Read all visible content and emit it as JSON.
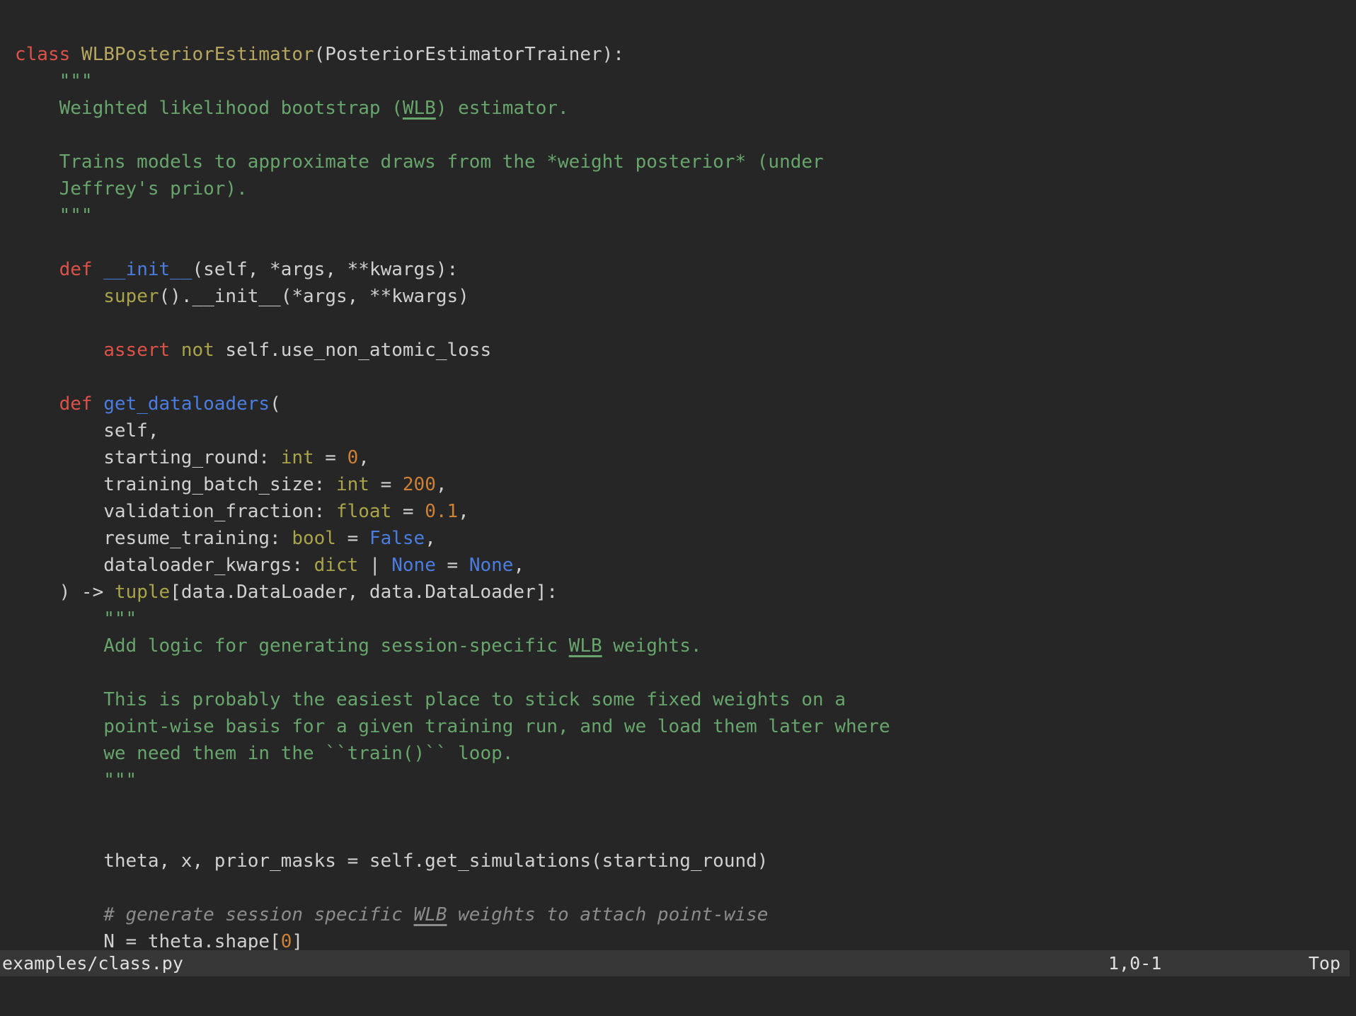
{
  "colors": {
    "background": "#262626",
    "text": "#d0d0d0",
    "keyword": "#dd5248",
    "class_name": "#b6a65f",
    "function": "#4b7de0",
    "constant": "#4b7de0",
    "type": "#a9a449",
    "string": "#67a56c",
    "number": "#cd8136",
    "comment": "#8c8c8c",
    "statusbar_bg": "#373737",
    "statusbar_text": "#e0e0e0"
  },
  "editor": {
    "code_lines": [
      [],
      [
        {
          "s": "kw",
          "t": "class "
        },
        {
          "s": "cls",
          "t": "WLBPosteriorEstimator"
        },
        {
          "s": "txt",
          "t": "(PosteriorEstimatorTrainer):"
        }
      ],
      [
        {
          "s": "str",
          "t": "    \"\"\""
        }
      ],
      [
        {
          "s": "str",
          "t": "    Weighted likelihood bootstrap ("
        },
        {
          "s": "strU",
          "t": "WLB"
        },
        {
          "s": "str",
          "t": ") estimator."
        }
      ],
      [],
      [
        {
          "s": "str",
          "t": "    Trains models to approximate draws from the *weight posterior* (under"
        }
      ],
      [
        {
          "s": "str",
          "t": "    Jeffrey's prior)."
        }
      ],
      [
        {
          "s": "str",
          "t": "    \"\"\""
        }
      ],
      [],
      [
        {
          "s": "txt",
          "t": "    "
        },
        {
          "s": "kw",
          "t": "def "
        },
        {
          "s": "fn",
          "t": "__init__"
        },
        {
          "s": "txt",
          "t": "(self, *args, **kwargs):"
        }
      ],
      [
        {
          "s": "txt",
          "t": "        "
        },
        {
          "s": "type",
          "t": "super"
        },
        {
          "s": "txt",
          "t": "().__init__(*args, **kwargs)"
        }
      ],
      [],
      [
        {
          "s": "txt",
          "t": "        "
        },
        {
          "s": "kw",
          "t": "assert"
        },
        {
          "s": "txt",
          "t": " "
        },
        {
          "s": "type",
          "t": "not"
        },
        {
          "s": "txt",
          "t": " self.use_non_atomic_loss"
        }
      ],
      [],
      [
        {
          "s": "txt",
          "t": "    "
        },
        {
          "s": "kw",
          "t": "def "
        },
        {
          "s": "fn",
          "t": "get_dataloaders"
        },
        {
          "s": "txt",
          "t": "("
        }
      ],
      [
        {
          "s": "txt",
          "t": "        self,"
        }
      ],
      [
        {
          "s": "txt",
          "t": "        starting_round: "
        },
        {
          "s": "type",
          "t": "int"
        },
        {
          "s": "txt",
          "t": " = "
        },
        {
          "s": "num",
          "t": "0"
        },
        {
          "s": "txt",
          "t": ","
        }
      ],
      [
        {
          "s": "txt",
          "t": "        training_batch_size: "
        },
        {
          "s": "type",
          "t": "int"
        },
        {
          "s": "txt",
          "t": " = "
        },
        {
          "s": "num",
          "t": "200"
        },
        {
          "s": "txt",
          "t": ","
        }
      ],
      [
        {
          "s": "txt",
          "t": "        validation_fraction: "
        },
        {
          "s": "type",
          "t": "float"
        },
        {
          "s": "txt",
          "t": " = "
        },
        {
          "s": "num",
          "t": "0.1"
        },
        {
          "s": "txt",
          "t": ","
        }
      ],
      [
        {
          "s": "txt",
          "t": "        resume_training: "
        },
        {
          "s": "type",
          "t": "bool"
        },
        {
          "s": "txt",
          "t": " = "
        },
        {
          "s": "const",
          "t": "False"
        },
        {
          "s": "txt",
          "t": ","
        }
      ],
      [
        {
          "s": "txt",
          "t": "        dataloader_kwargs: "
        },
        {
          "s": "type",
          "t": "dict"
        },
        {
          "s": "txt",
          "t": " | "
        },
        {
          "s": "const",
          "t": "None"
        },
        {
          "s": "txt",
          "t": " = "
        },
        {
          "s": "const",
          "t": "None"
        },
        {
          "s": "txt",
          "t": ","
        }
      ],
      [
        {
          "s": "txt",
          "t": "    ) -> "
        },
        {
          "s": "type",
          "t": "tuple"
        },
        {
          "s": "txt",
          "t": "[data.DataLoader, data.DataLoader]:"
        }
      ],
      [
        {
          "s": "str",
          "t": "        \"\"\""
        }
      ],
      [
        {
          "s": "str",
          "t": "        Add logic for generating session-specific "
        },
        {
          "s": "strU",
          "t": "WLB"
        },
        {
          "s": "str",
          "t": " weights."
        }
      ],
      [],
      [
        {
          "s": "str",
          "t": "        This is probably the easiest place to stick some fixed weights on a"
        }
      ],
      [
        {
          "s": "str",
          "t": "        point-wise basis for a given training run, and we load them later where"
        }
      ],
      [
        {
          "s": "str",
          "t": "        we need them in the ``train()`` loop."
        }
      ],
      [
        {
          "s": "str",
          "t": "        \"\"\""
        }
      ],
      [],
      [],
      [
        {
          "s": "txt",
          "t": "        theta, x, prior_masks = self.get_simulations(starting_round)"
        }
      ],
      [],
      [
        {
          "s": "com",
          "t": "        # generate session specific "
        },
        {
          "s": "comU",
          "t": "WLB"
        },
        {
          "s": "com",
          "t": " weights to attach point-wise"
        }
      ],
      [
        {
          "s": "txt",
          "t": "        N = theta.shape["
        },
        {
          "s": "num",
          "t": "0"
        },
        {
          "s": "txt",
          "t": "]"
        }
      ]
    ]
  },
  "statusbar": {
    "filename": "examples/class.py",
    "ruler": "1,0-1",
    "scroll_position": "Top"
  }
}
